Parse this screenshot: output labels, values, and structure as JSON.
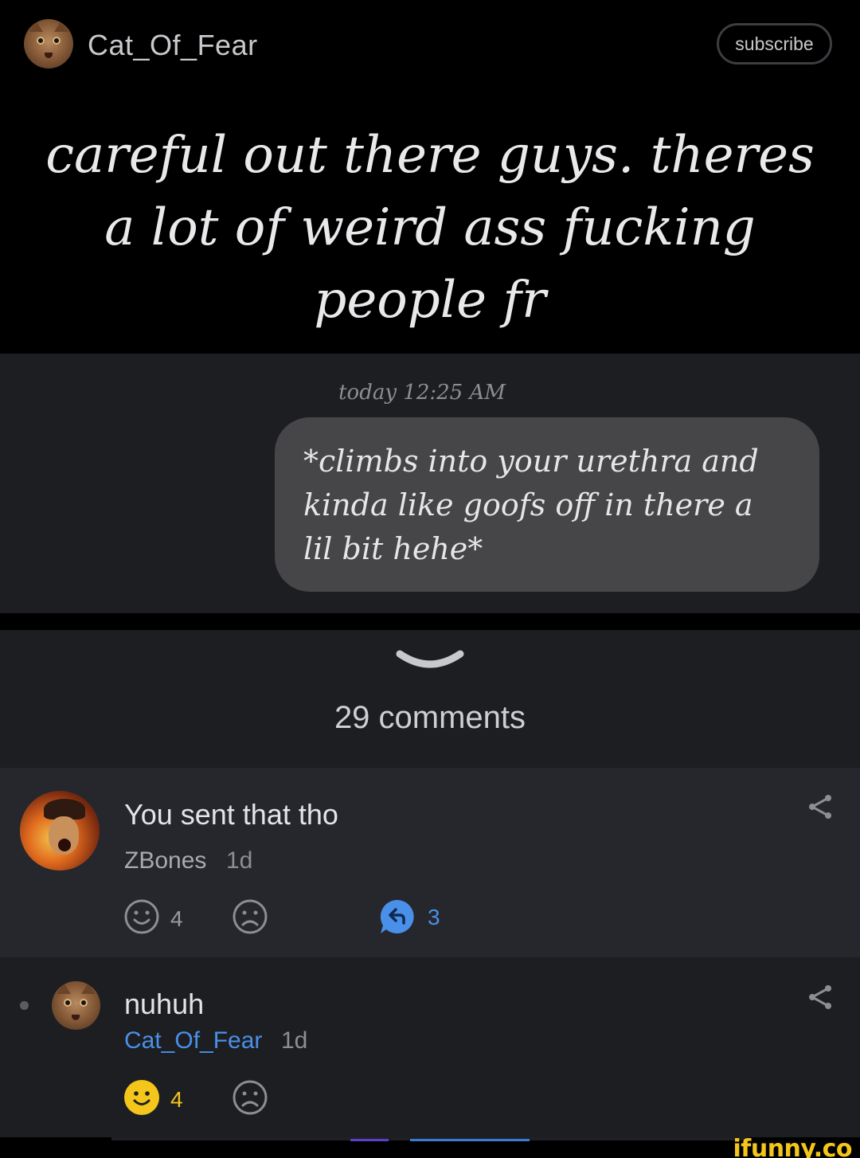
{
  "header": {
    "username": "Cat_Of_Fear",
    "subscribe_label": "subscribe"
  },
  "post": {
    "caption": "careful out there guys. theres a lot of weird ass fucking people fr",
    "chat_time": "today 12:25 AM",
    "chat_message": "*climbs into your urethra and kinda like goofs off in there a lil bit hehe*"
  },
  "comments_section": {
    "count_label": "29 comments",
    "comments": [
      {
        "text": "You sent that tho",
        "author": "ZBones",
        "age": "1d",
        "smile_count": "4",
        "reply_count": "3"
      },
      {
        "text": "nuhuh",
        "author": "Cat_Of_Fear",
        "age": "1d",
        "smile_count": "4"
      }
    ]
  },
  "watermark": "ifunny.co",
  "colors": {
    "accent_blue": "#4a90e8",
    "smile_yellow": "#f4c51a",
    "background": "#1d1e22"
  }
}
